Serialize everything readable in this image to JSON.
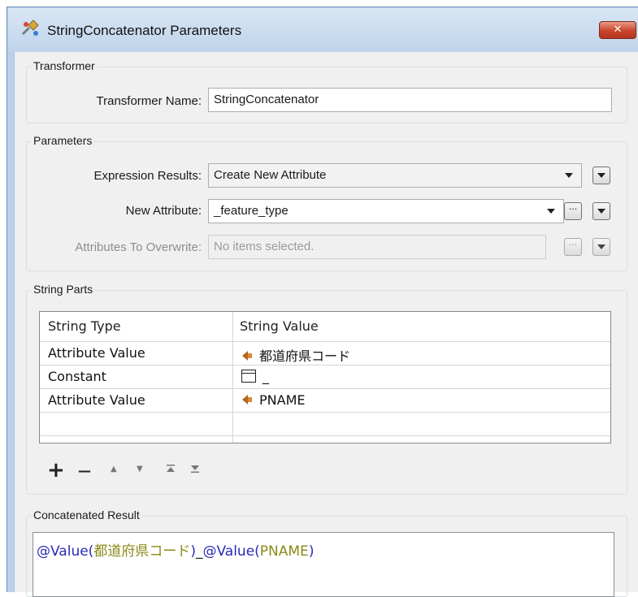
{
  "window": {
    "title": "StringConcatenator Parameters",
    "close_glyph": "✕"
  },
  "transformer_group": {
    "label": "Transformer",
    "name_label": "Transformer Name:",
    "name_value": "StringConcatenator"
  },
  "parameters_group": {
    "label": "Parameters",
    "expression_results_label": "Expression Results:",
    "expression_results_value": "Create New Attribute",
    "new_attribute_label": "New Attribute:",
    "new_attribute_value": "_feature_type",
    "attributes_overwrite_label": "Attributes To Overwrite:",
    "attributes_overwrite_placeholder": "No items selected.",
    "ellipsis_glyph": "···"
  },
  "string_parts": {
    "label": "String Parts",
    "columns": [
      "String Type",
      "String Value"
    ],
    "rows": [
      {
        "type": "Attribute Value",
        "value": "都道府県コード",
        "icon": "attribute-icon"
      },
      {
        "type": "Constant",
        "value": "_",
        "icon": "constant-icon"
      },
      {
        "type": "Attribute Value",
        "value": "PNAME",
        "icon": "attribute-icon"
      },
      {
        "type": "",
        "value": "",
        "icon": ""
      }
    ],
    "toolbar": {
      "add": "+",
      "remove": "—",
      "move_up": "▲",
      "move_down": "▼",
      "move_top": "⯭",
      "move_bottom": "⯯"
    }
  },
  "concatenated_result": {
    "label": "Concatenated Result",
    "tokens": [
      {
        "text": "@Value(",
        "kind": "func"
      },
      {
        "text": "都道府県コード",
        "kind": "arg"
      },
      {
        "text": ")",
        "kind": "func"
      },
      {
        "text": "_",
        "kind": "plain"
      },
      {
        "text": "@Value(",
        "kind": "func"
      },
      {
        "text": "PNAME",
        "kind": "arg"
      },
      {
        "text": ")",
        "kind": "func"
      }
    ]
  },
  "colors": {
    "attribute_icon": "#b5651d",
    "func_text": "#2a2ab8",
    "arg_text": "#8a8a1a"
  }
}
